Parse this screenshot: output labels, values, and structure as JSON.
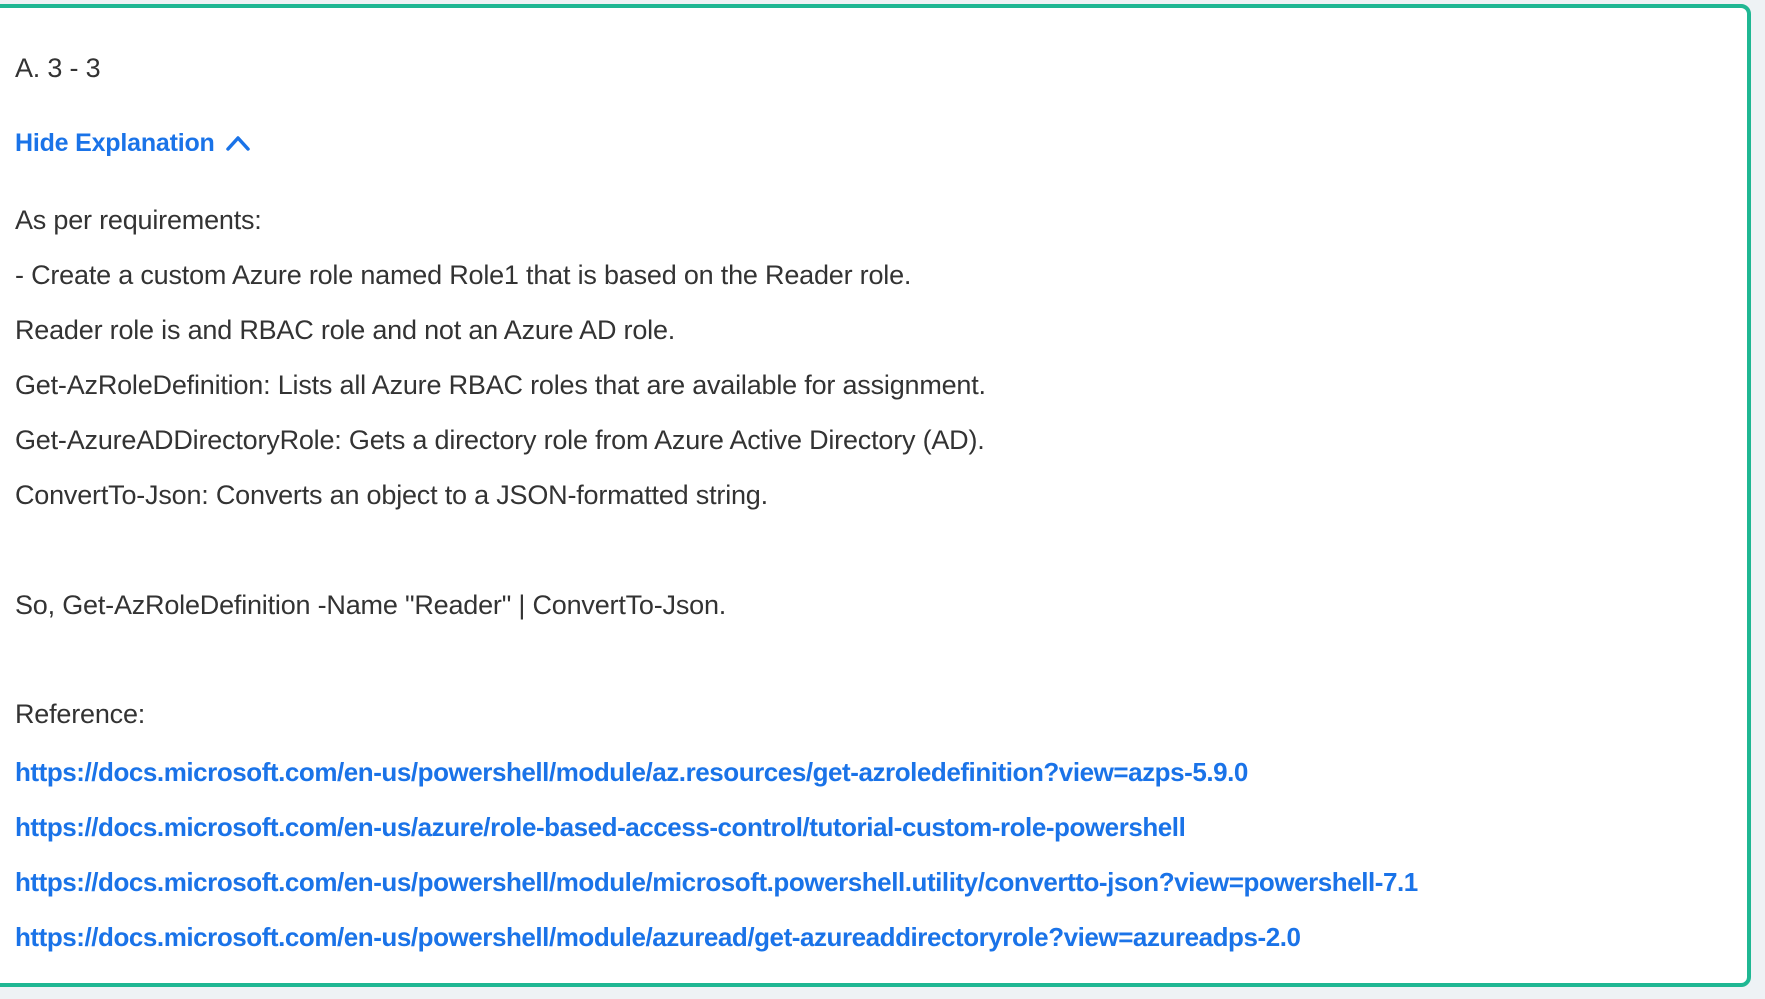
{
  "answer": "A. 3 - 3",
  "toggle": {
    "label": "Hide Explanation",
    "icon": "chevron-up-icon"
  },
  "explanation": {
    "lines": [
      "As per requirements:",
      "- Create a custom Azure role named Role1 that is based on the Reader role.",
      "Reader role is and RBAC role and not an Azure AD role.",
      "Get-AzRoleDefinition: Lists all Azure RBAC roles that are available for assignment.",
      "Get-AzureADDirectoryRole: Gets a directory role from Azure Active Directory (AD).",
      "ConvertTo-Json: Converts an object to a JSON-formatted string."
    ],
    "conclusion": "So, Get-AzRoleDefinition -Name \"Reader\" | ConvertTo-Json.",
    "reference_label": "Reference:",
    "links": [
      "https://docs.microsoft.com/en-us/powershell/module/az.resources/get-azroledefinition?view=azps-5.9.0",
      "https://docs.microsoft.com/en-us/azure/role-based-access-control/tutorial-custom-role-powershell",
      "https://docs.microsoft.com/en-us/powershell/module/microsoft.powershell.utility/convertto-json?view=powershell-7.1",
      "https://docs.microsoft.com/en-us/powershell/module/azuread/get-azureaddirectoryrole?view=azureadps-2.0"
    ]
  },
  "colors": {
    "accent": "#1a73e8",
    "border": "#1fb793",
    "text": "#333333"
  }
}
